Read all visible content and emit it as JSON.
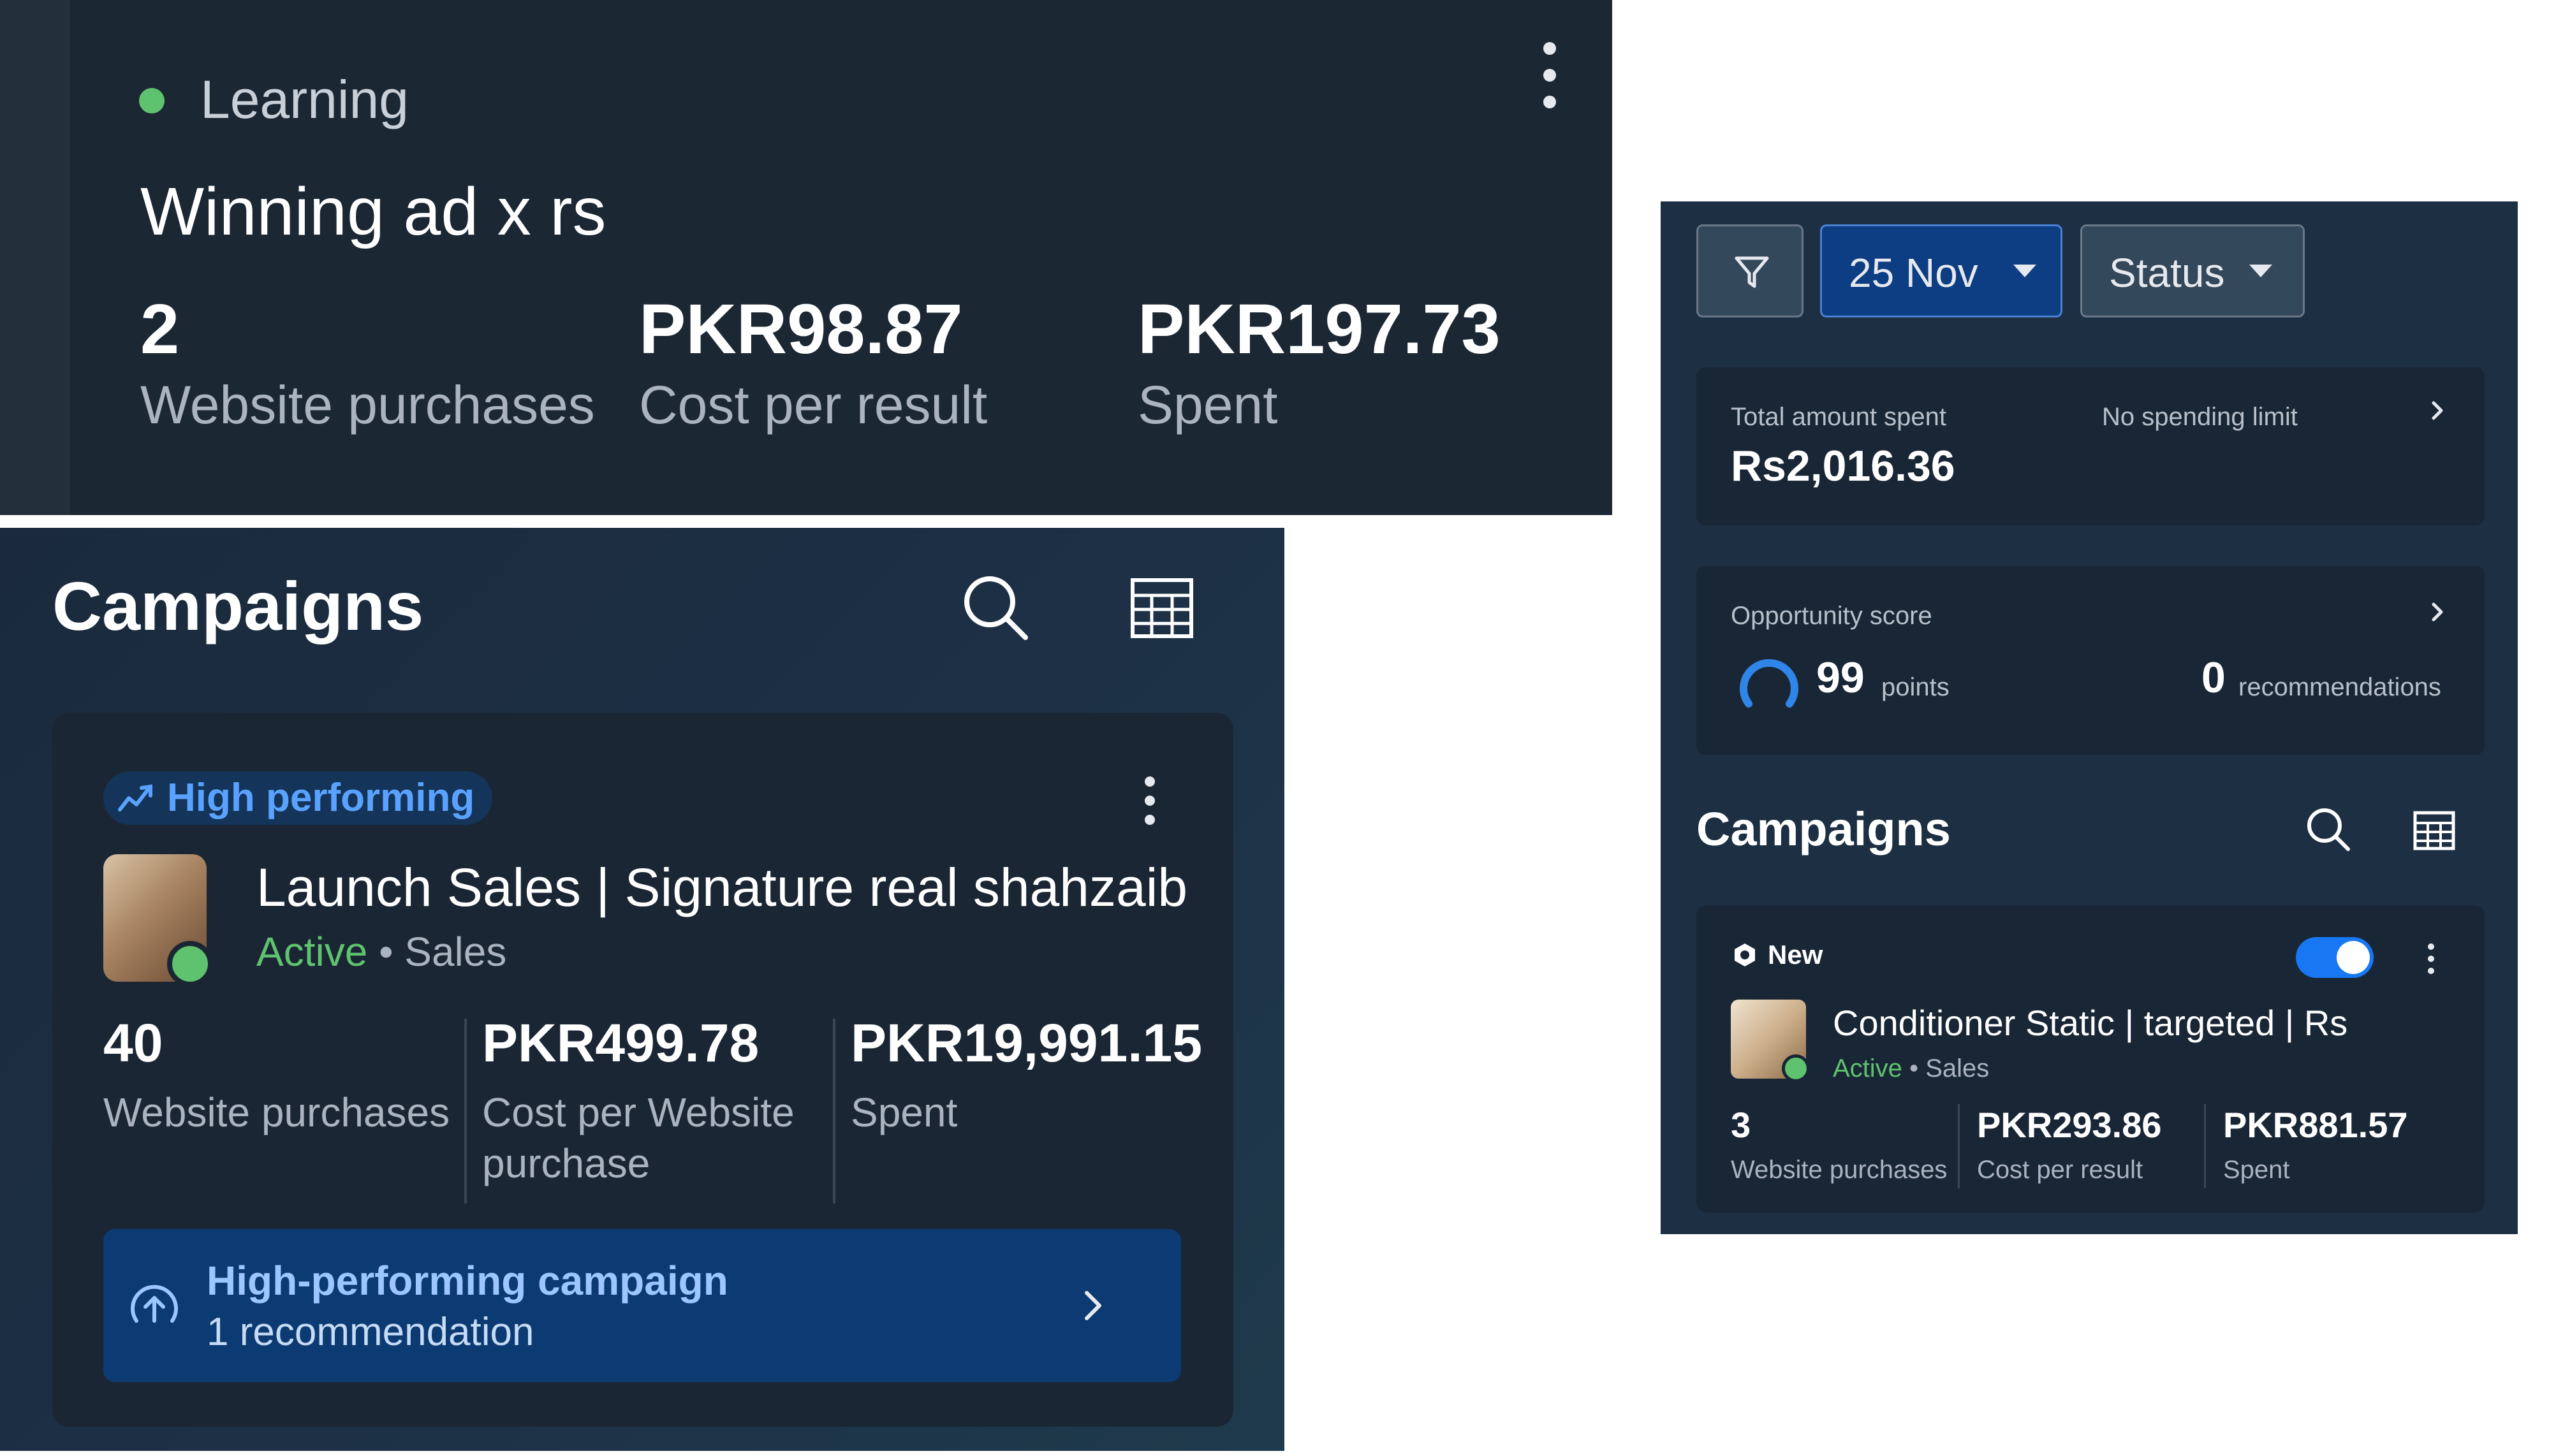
{
  "ad_card": {
    "status": "Learning",
    "name": "Winning ad x rs",
    "metrics": [
      {
        "value": "2",
        "label": "Website purchases"
      },
      {
        "value": "PKR98.87",
        "label": "Cost per result"
      },
      {
        "value": "PKR197.73",
        "label": "Spent"
      }
    ]
  },
  "campaigns_panel": {
    "heading": "Campaigns",
    "campaign": {
      "badge": "High performing",
      "name": "Launch Sales | Signature real shahzaib",
      "status": "Active",
      "separator": "•",
      "objective": "Sales",
      "metrics": [
        {
          "value": "40",
          "label": "Website purchases"
        },
        {
          "value": "PKR499.78",
          "label": "Cost per Website purchase"
        },
        {
          "value": "PKR19,991.15",
          "label": "Spent"
        }
      ],
      "recommendation": {
        "title": "High-performing campaign",
        "subtitle": "1 recommendation"
      }
    }
  },
  "overview_panel": {
    "filters": {
      "date": "25 Nov",
      "status": "Status"
    },
    "spend": {
      "label": "Total amount spent",
      "limit": "No spending limit",
      "amount": "Rs2,016.36"
    },
    "opportunity": {
      "label": "Opportunity score",
      "score": "99",
      "score_unit": "points",
      "recommendations": "0",
      "recommendations_label": "recommendations"
    },
    "heading": "Campaigns",
    "campaign": {
      "badge": "New",
      "name": "Conditioner Static | targeted | Rs",
      "status": "Active",
      "separator": "•",
      "objective": "Sales",
      "toggle_on": true,
      "metrics": [
        {
          "value": "3",
          "label": "Website purchases"
        },
        {
          "value": "PKR293.86",
          "label": "Cost per result"
        },
        {
          "value": "PKR881.57",
          "label": "Spent"
        }
      ]
    }
  },
  "colors": {
    "accent": "#1877f2",
    "active": "#5fc26e",
    "badge_text": "#5aa2ff",
    "background": "#1b2733"
  }
}
